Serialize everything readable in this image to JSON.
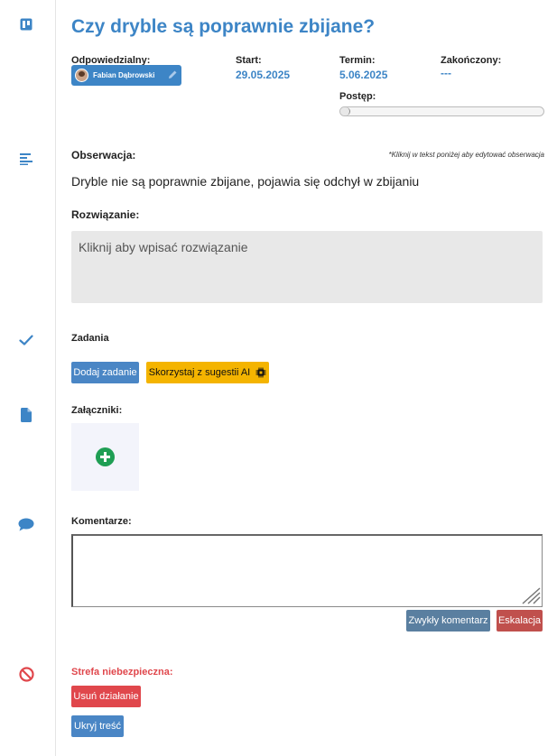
{
  "title": "Czy dryble są poprawnie zbijane?",
  "meta": {
    "owner_label": "Odpowiedzialny:",
    "owner_name": "Fabian Dąbrowski",
    "start_label": "Start:",
    "start_value": "29.05.2025",
    "due_label": "Termin:",
    "due_value": "5.06.2025",
    "closed_label": "Zakończony:",
    "closed_value": "---",
    "progress_label": "Postęp:",
    "progress_fraction": 0.05
  },
  "observation": {
    "label": "Obserwacja:",
    "hint": "*Kliknij w tekst poniżej aby edytować obserwacja",
    "text": "Dryble nie są poprawnie zbijane, pojawia się odchył w zbijaniu"
  },
  "solution": {
    "label": "Rozwiązanie:",
    "placeholder": "Kliknij aby wpisać rozwiązanie"
  },
  "tasks": {
    "label": "Zadania",
    "add_button": "Dodaj zadanie",
    "ai_button": "Skorzystaj z sugestii AI"
  },
  "attachments": {
    "label": "Załączniki:"
  },
  "comments": {
    "label": "Komentarze:",
    "normal_button": "Zwykły komentarz",
    "escalation_button": "Eskalacja"
  },
  "danger": {
    "label": "Strefa niebezpieczna:",
    "delete_button": "Usuń działanie",
    "hide_button": "Ukryj treść"
  },
  "icons": {
    "board": "board-icon",
    "text": "text-lines-icon",
    "check": "check-icon",
    "file": "file-icon",
    "comment": "comment-icon",
    "ban": "ban-icon"
  },
  "colors": {
    "accent": "#3d85c6",
    "ai": "#f4b400",
    "danger": "#e0474c",
    "escalation": "#c0504d",
    "add_attachment": "#1f9e54"
  }
}
